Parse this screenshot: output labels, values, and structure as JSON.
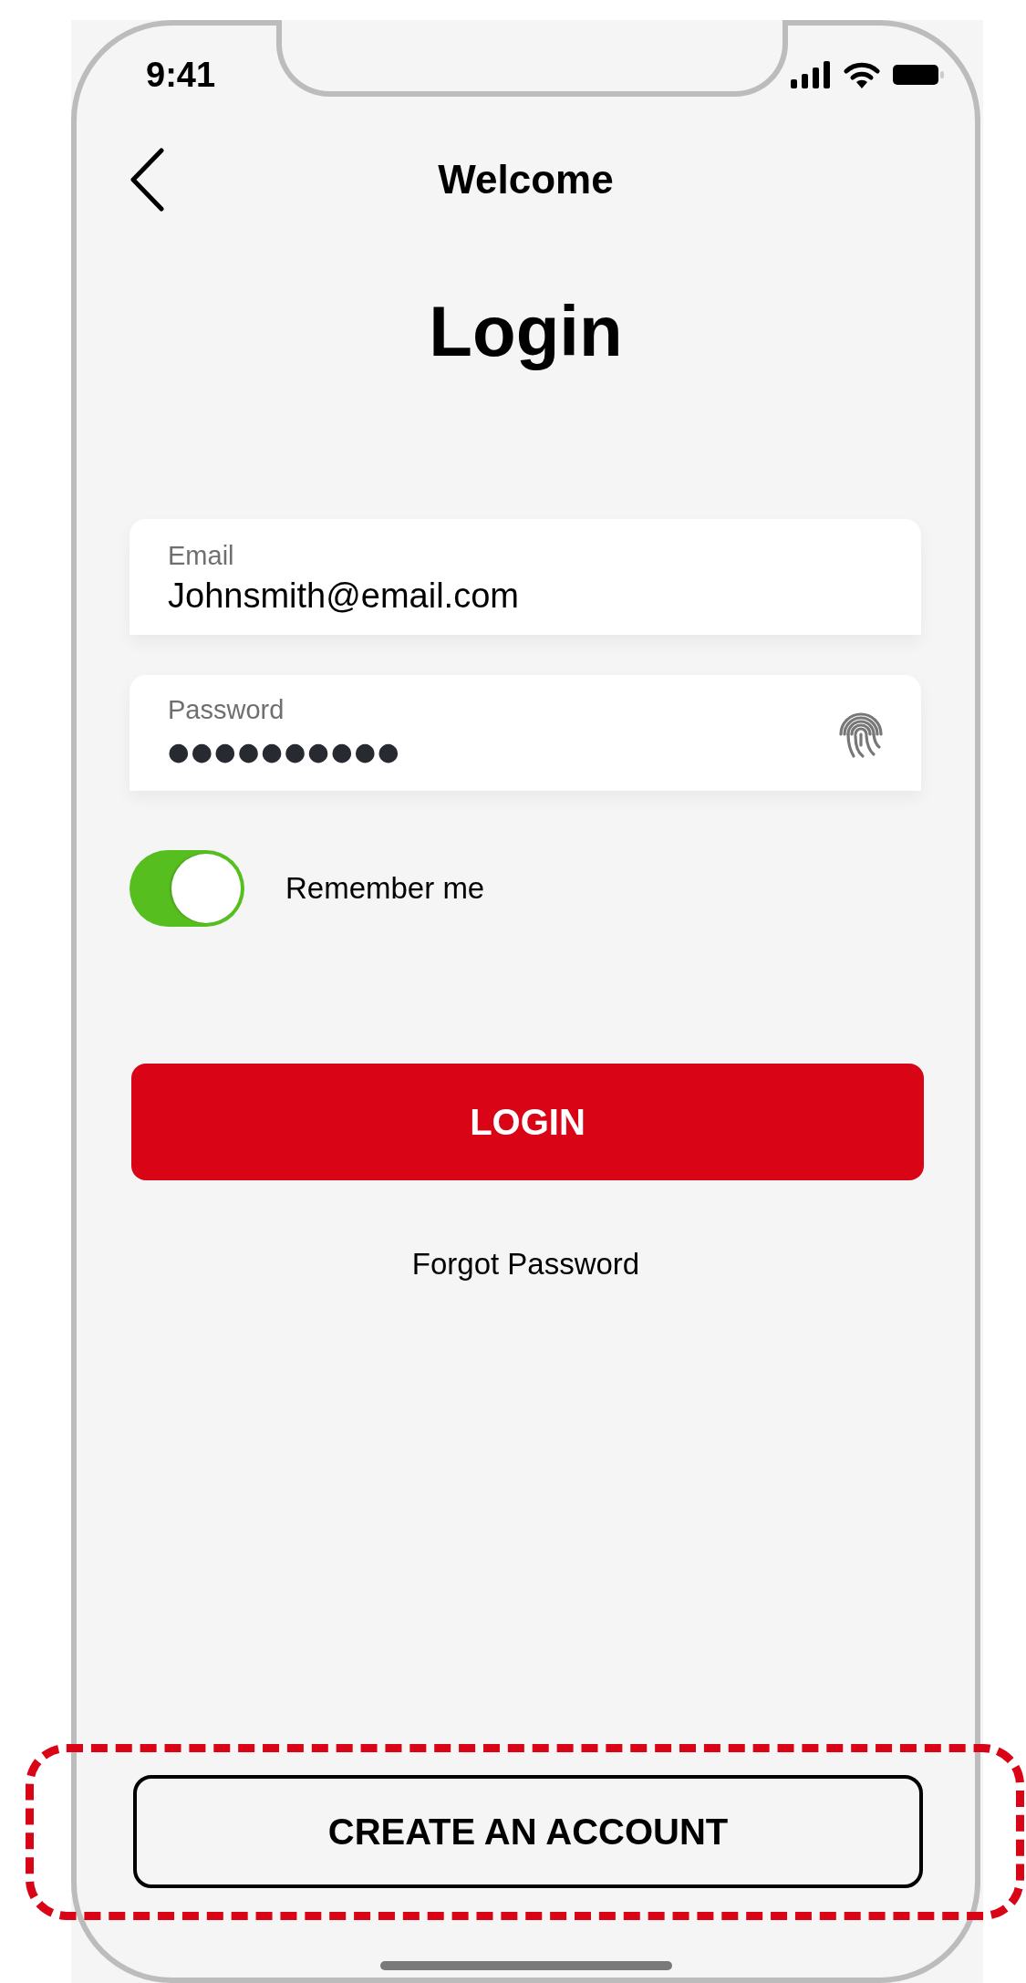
{
  "status_bar": {
    "time": "9:41"
  },
  "nav": {
    "title": "Welcome"
  },
  "heading": "Login",
  "fields": [
    {
      "kind": "text",
      "label": "Email",
      "value": "Johnsmith@email.com"
    },
    {
      "kind": "password",
      "label": "Password",
      "value": "●●●●●●●●●●"
    }
  ],
  "remember": {
    "label": "Remember me",
    "on": true
  },
  "login_button": {
    "label": "LOGIN"
  },
  "forgot_link": {
    "label": "Forgot Password"
  },
  "create_button": {
    "label": "CREATE AN ACCOUNT",
    "highlighted": true
  }
}
